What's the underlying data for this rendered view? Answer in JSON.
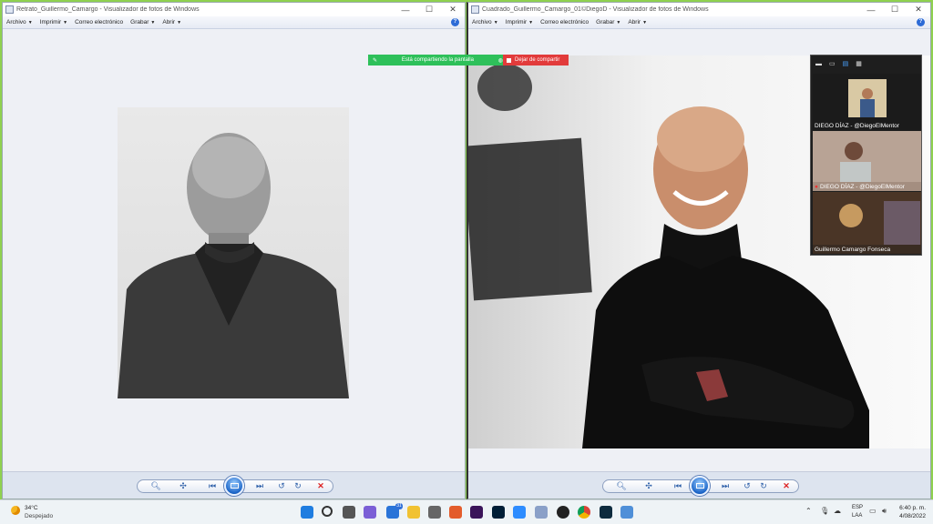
{
  "left_window": {
    "title": "Retrato_Guillermo_Camargo - Visualizador de fotos de Windows",
    "menu": [
      "Archivo",
      "Imprimir",
      "Correo electrónico",
      "Grabar",
      "Abrir"
    ]
  },
  "right_window": {
    "title": "Cuadrado_Guillermo_Camargo_01©DiegoD - Visualizador de fotos de Windows",
    "menu": [
      "Archivo",
      "Imprimir",
      "Correo electrónico",
      "Grabar",
      "Abrir"
    ]
  },
  "window_controls": {
    "minimize": "—",
    "maximize": "☐",
    "close": "✕"
  },
  "share_banner": {
    "sharing_text": "Está compartiendo la pantalla",
    "stop_text": "Dejar de compartir",
    "colors": {
      "sharing": "#2ec05a",
      "stop": "#e23b3b"
    }
  },
  "zoom_gallery": {
    "tiles": [
      {
        "label": "DIEGO DÍAZ - @DiegoElMentor",
        "muted": false
      },
      {
        "label": "DIEGO DÍAZ - @DiegoElMentor",
        "muted": true
      },
      {
        "label": "Guillermo Camargo Fonseca",
        "muted": false
      }
    ]
  },
  "taskbar": {
    "weather_temp": "34°C",
    "weather_desc": "Despejado",
    "notification_badge": "31",
    "language_line1": "ESP",
    "language_line2": "LAA",
    "time": "6:40 p. m.",
    "date": "4/08/2022",
    "apps": [
      "start-icon",
      "search-icon",
      "task-view-icon",
      "teams-chat-icon",
      "store-icon",
      "file-explorer-icon",
      "calculator-icon",
      "office-icon",
      "premiere-icon",
      "photoshop-icon",
      "zoom-icon",
      "media-icon",
      "obs-icon",
      "chrome-icon",
      "lightroom-icon",
      "photos-icon"
    ]
  }
}
